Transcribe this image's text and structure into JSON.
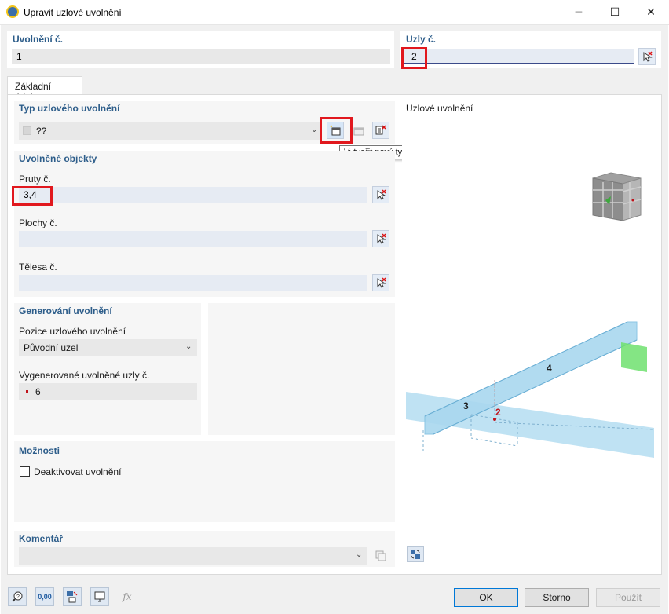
{
  "window": {
    "title": "Upravit uzlové uvolnění"
  },
  "header": {
    "release_no_label": "Uvolnění č.",
    "release_no_value": "1",
    "nodes_label": "Uzly č.",
    "nodes_value": "2"
  },
  "tabs": [
    {
      "label": "Základní údaje"
    }
  ],
  "release_type": {
    "header": "Typ uzlového uvolnění",
    "value": "??",
    "tooltip": "Vytvořit nový typ uvolnění..."
  },
  "released_objects": {
    "header": "Uvolněné objekty",
    "members_label": "Pruty č.",
    "members_value": "3,4",
    "surfaces_label": "Plochy č.",
    "surfaces_value": "",
    "solids_label": "Tělesa č.",
    "solids_value": ""
  },
  "generation": {
    "header": "Generování uvolnění",
    "position_label": "Pozice uzlového uvolnění",
    "position_value": "Původní uzel",
    "generated_label": "Vygenerované uvolněné uzly č.",
    "generated_value": "6"
  },
  "options": {
    "header": "Možnosti",
    "deactivate_label": "Deaktivovat uvolnění",
    "deactivate_checked": false
  },
  "comment": {
    "header": "Komentář",
    "value": ""
  },
  "preview": {
    "header": "Uzlové uvolnění",
    "member_labels": [
      "3",
      "4"
    ],
    "node_label": "2",
    "beam_color": "#a9d8ef",
    "node_color": "#c0121a",
    "release_color": "#6ee06e"
  },
  "footer": {
    "ok_label": "OK",
    "cancel_label": "Storno",
    "apply_label": "Použít",
    "units_icon_text": "0,00",
    "formula_icon_text": "fx"
  },
  "colors": {
    "accent": "#2d5d8a",
    "highlight": "#e1181e"
  }
}
